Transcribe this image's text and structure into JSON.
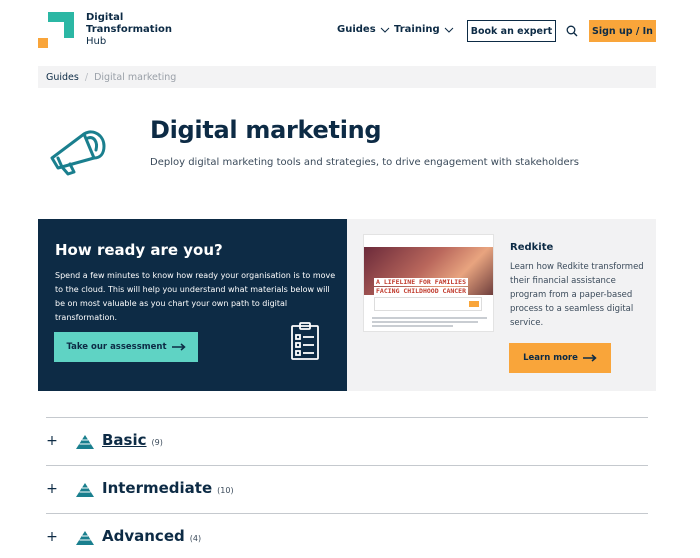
{
  "header": {
    "logo_lines": [
      "Digital",
      "Transformation",
      "Hub"
    ],
    "nav": [
      {
        "label": "Guides"
      },
      {
        "label": "Training"
      }
    ],
    "book_expert_label": "Book an expert",
    "signup_label": "Sign up / In",
    "icons": {
      "search": "search-icon",
      "chevron": "chevron-down-icon"
    }
  },
  "breadcrumb": {
    "items": [
      "Guides",
      "Digital marketing"
    ],
    "separator": "/"
  },
  "hero": {
    "title": "Digital marketing",
    "subtitle": "Deploy digital marketing tools and strategies, to drive engagement with stakeholders",
    "icon": "megaphone-icon"
  },
  "readiness": {
    "title": "How ready are you?",
    "text": "Spend a few minutes to know how ready your organisation is to move to the cloud. This will help you understand what materials below will be on most valuable as you chart your own path to digital transformation.",
    "button_label": "Take our assessment",
    "icon": "clipboard-checklist-icon"
  },
  "case_study": {
    "title": "Redkite",
    "text": "Learn how Redkite transformed their financial assistance program from a paper-based process to a seamless digital service.",
    "button_label": "Learn more",
    "thumbnail_banner": [
      "A LIFELINE FOR FAMILIES",
      "FACING CHILDHOOD CANCER"
    ]
  },
  "accordion": [
    {
      "label": "Basic",
      "count": "(9)"
    },
    {
      "label": "Intermediate",
      "count": "(10)"
    },
    {
      "label": "Advanced",
      "count": "(4)"
    }
  ],
  "colors": {
    "navy": "#0d2b45",
    "orange": "#f9a53a",
    "teal": "#5fd3c4",
    "light_gray": "#f2f2f3"
  }
}
